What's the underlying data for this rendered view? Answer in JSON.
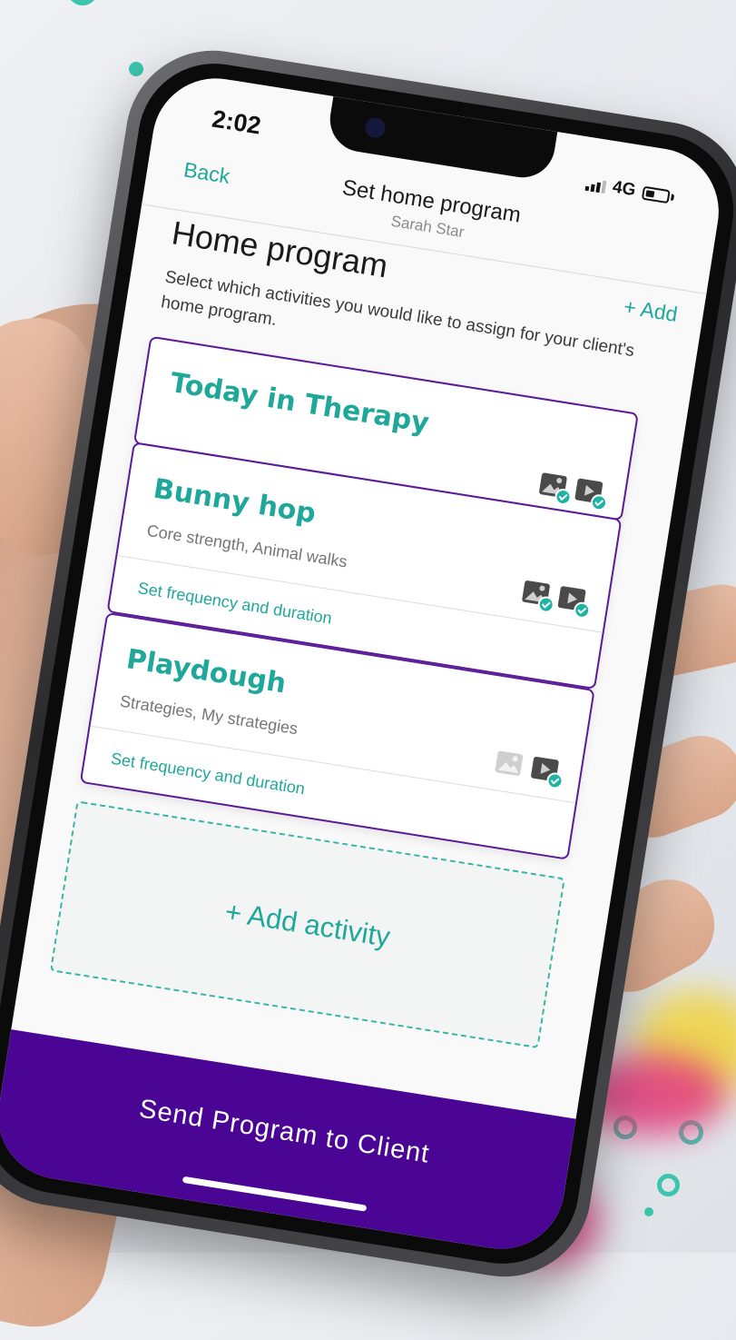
{
  "status_bar": {
    "time": "2:02",
    "network": "4G"
  },
  "nav": {
    "back_label": "Back",
    "title": "Set home program",
    "subtitle": "Sarah Star",
    "add_label": "+ Add"
  },
  "page": {
    "title": "Home program",
    "description": "Select which activities you would like to assign for your client's home program."
  },
  "cards": [
    {
      "title": "Today in Therapy",
      "tags": "",
      "link": "",
      "image_checked": true,
      "video_checked": true
    },
    {
      "title": "Bunny hop",
      "tags": "Core strength, Animal walks",
      "link": "Set frequency and duration",
      "image_checked": true,
      "video_checked": true
    },
    {
      "title": "Playdough",
      "tags": "Strategies, My strategies",
      "link": "Set frequency and duration",
      "image_checked": false,
      "video_checked": true
    }
  ],
  "add_activity_label": "+ Add activity",
  "send_button_label": "Send Program to Client",
  "colors": {
    "accent": "#1fa89a",
    "brand_purple": "#4a0595",
    "card_border": "#5b1a96"
  },
  "icons": [
    "image-icon",
    "video-icon",
    "check-icon",
    "signal-icon",
    "battery-icon"
  ]
}
